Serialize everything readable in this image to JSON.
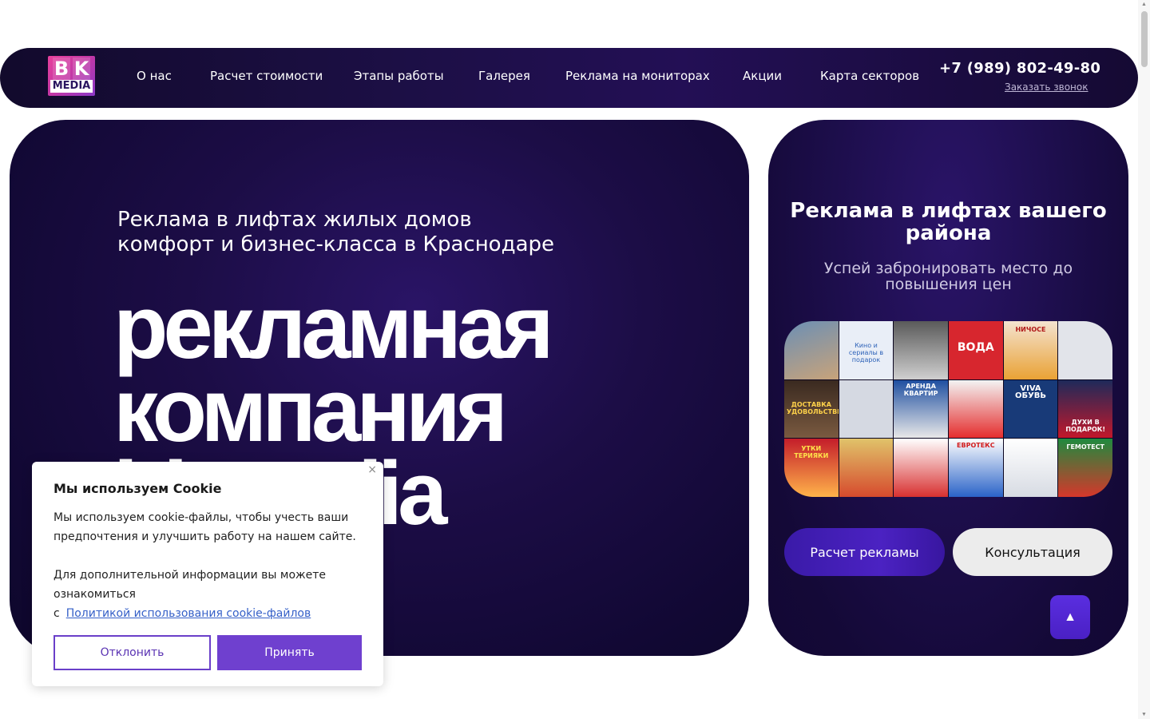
{
  "header": {
    "logo_top": "BK",
    "logo_bottom": "MEDIA",
    "nav": [
      "О нас",
      "Расчет стоимости",
      "Этапы работы",
      "Галерея",
      "Реклама на мониторах",
      "Акции",
      "Карта секторов"
    ],
    "phone": "+7 (989) 802-49-80",
    "callback_label": "Заказать звонок"
  },
  "hero": {
    "subtitle": "Реклама в лифтах жилых домов комфорт и бизнес-класса в Краснодаре",
    "big_line1": "рекламная",
    "big_line2": "компания",
    "big_line3": "bkmedia"
  },
  "side": {
    "title": "Реклама в лифтах вашего района",
    "subtitle": "Успей забронировать место до повышения цен",
    "collage_labels": [
      "Кино и сериалы в подарок",
      "",
      "ВОДА",
      "НИЧОСЕ",
      "",
      "ДОСТАВКА УДОВОЛЬСТВИЯ",
      "",
      "",
      "АРЕНДА КВАРТИР",
      "VIVA ОБУВЬ",
      "ДУХИ В ПОДАРОК!",
      "",
      "УТКИ ТЕРИЯКИ",
      "",
      "",
      "ЕВРОТЕКС",
      "",
      "ГЕМОТЕСТ"
    ],
    "btn_calc": "Расчет рекламы",
    "btn_consult": "Консультация",
    "up_arrow": "▲"
  },
  "cookie": {
    "close": "×",
    "title": "Мы используем Cookie",
    "text1": "Мы используем cookie-файлы, чтобы учесть ваши предпочтения и улучшить работу на нашем сайте.",
    "text2": "Для дополнительной информации вы можете ознакомиться",
    "prefix": "с",
    "link": "Политикой использования cookie-файлов",
    "decline": "Отклонить",
    "accept": "Принять"
  }
}
